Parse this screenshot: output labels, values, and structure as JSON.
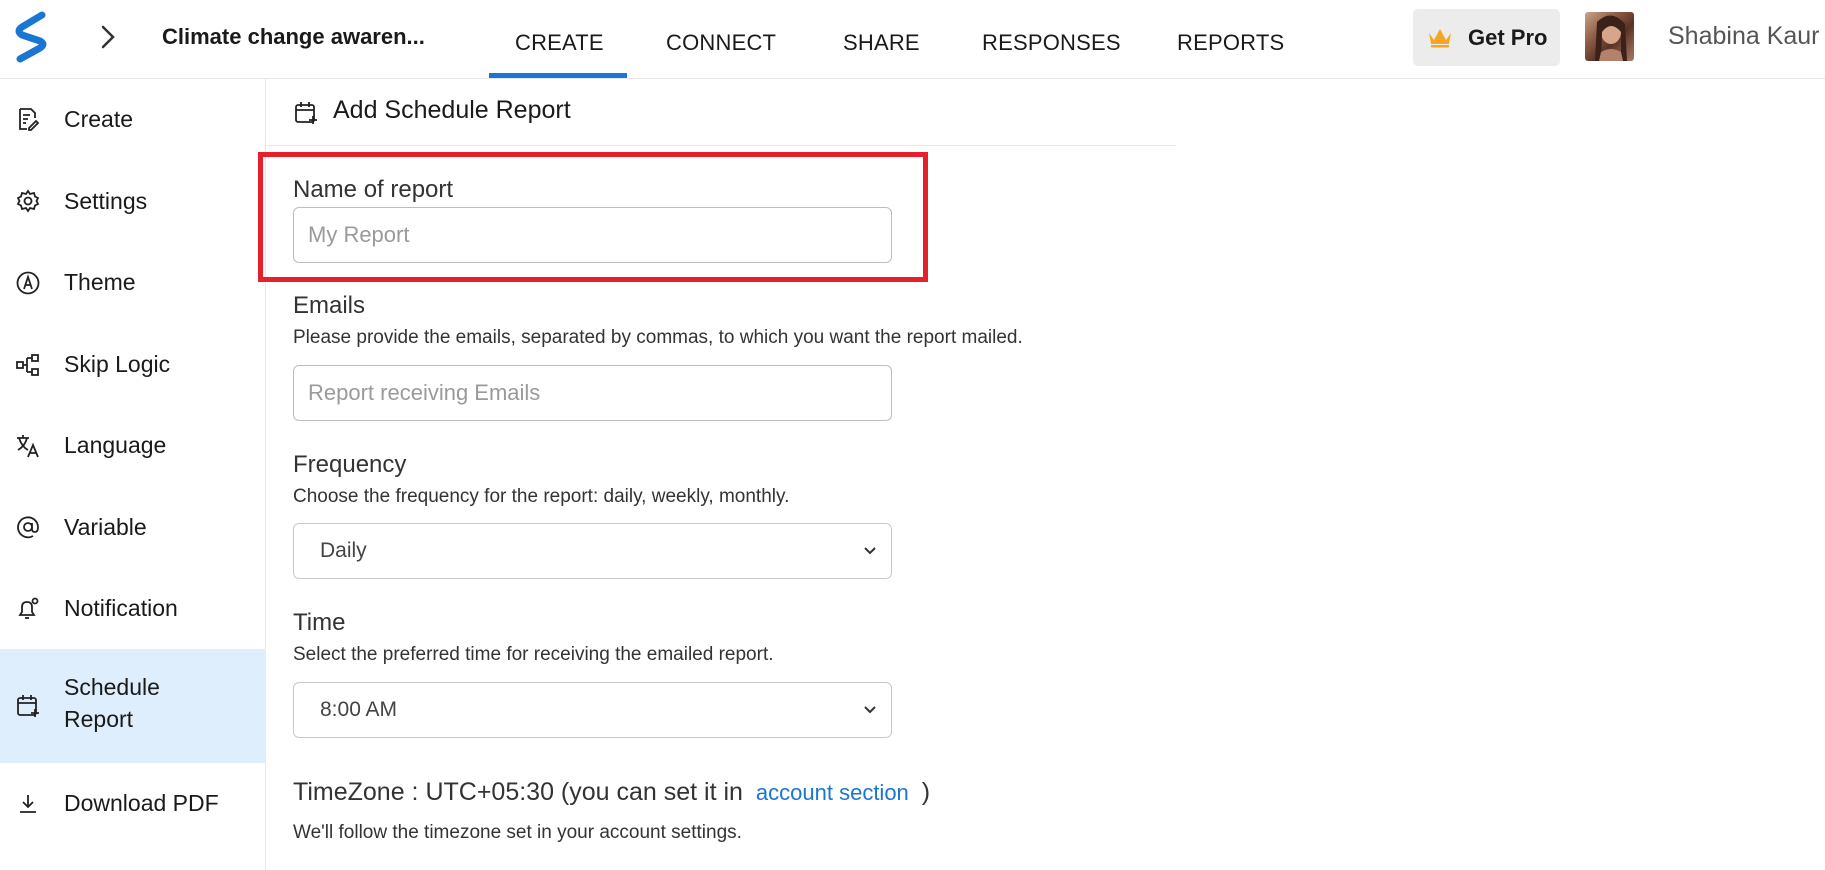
{
  "header": {
    "survey_title": "Climate change awaren...",
    "tabs": [
      {
        "label": "CREATE",
        "active": true
      },
      {
        "label": "CONNECT",
        "active": false
      },
      {
        "label": "SHARE",
        "active": false
      },
      {
        "label": "RESPONSES",
        "active": false
      },
      {
        "label": "REPORTS",
        "active": false
      }
    ],
    "get_pro_label": "Get Pro",
    "user_name": "Shabina Kaur",
    "accent_color": "#1976d2"
  },
  "sidebar": {
    "items": [
      {
        "label": "Create",
        "icon": "edit-document-icon",
        "active": false
      },
      {
        "label": "Settings",
        "icon": "gear-icon",
        "active": false
      },
      {
        "label": "Theme",
        "icon": "theme-icon",
        "active": false
      },
      {
        "label": "Skip Logic",
        "icon": "flow-icon",
        "active": false
      },
      {
        "label": "Language",
        "icon": "translate-icon",
        "active": false
      },
      {
        "label": "Variable",
        "icon": "at-sign-icon",
        "active": false
      },
      {
        "label": "Notification",
        "icon": "bell-icon",
        "active": false
      },
      {
        "label": "Schedule\nReport",
        "icon": "calendar-add-icon",
        "active": true
      },
      {
        "label": "Download PDF",
        "icon": "download-icon",
        "active": false
      }
    ],
    "active_bg": "#deeefc"
  },
  "main": {
    "title": "Add Schedule Report",
    "name_field": {
      "label": "Name of report",
      "placeholder": "My Report",
      "value": ""
    },
    "emails_field": {
      "label": "Emails",
      "help": "Please provide the emails, separated by commas, to which you want the report mailed.",
      "placeholder": "Report receiving Emails",
      "value": ""
    },
    "frequency_field": {
      "label": "Frequency",
      "help": "Choose the frequency for the report: daily, weekly, monthly.",
      "selected": "Daily"
    },
    "time_field": {
      "label": "Time",
      "help": "Select the preferred time for receiving the emailed report.",
      "selected": "8:00 AM"
    },
    "timezone": {
      "prefix": "TimeZone : UTC+05:30 (you can set it in",
      "link": "account section",
      "suffix": ")",
      "note": "We'll follow the timezone set in your account settings."
    },
    "highlight_color": "#e5202a"
  }
}
